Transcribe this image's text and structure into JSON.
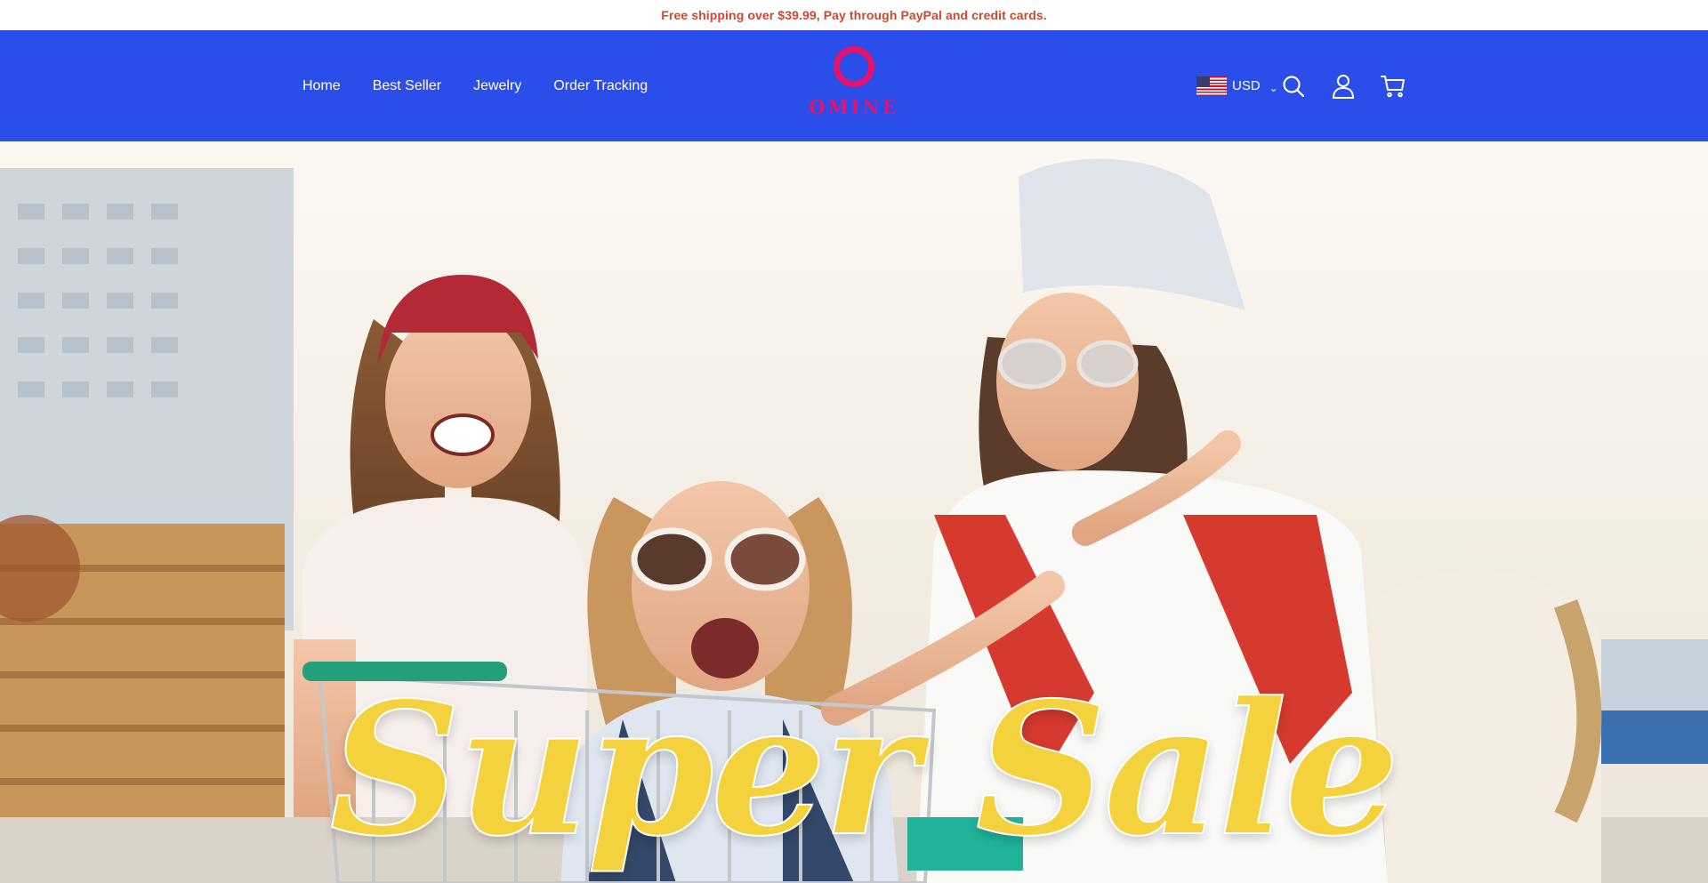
{
  "announcement": "Free shipping over $39.99, Pay through PayPal and credit cards.",
  "nav": {
    "items": [
      {
        "label": "Home"
      },
      {
        "label": "Best Seller"
      },
      {
        "label": "Jewelry"
      },
      {
        "label": "Order Tracking"
      }
    ]
  },
  "logo": {
    "text": "OMINE"
  },
  "currency": {
    "code": "USD",
    "flag_icon": "us-flag-icon",
    "chevron_icon": "chevron-down-icon"
  },
  "toolbar_icons": [
    "search-icon",
    "user-icon",
    "cart-icon"
  ],
  "hero": {
    "headline": "Super Sale"
  },
  "colors": {
    "announcement_text": "#d4462b",
    "header_bg": "#2b4eea",
    "logo": "#e6126b",
    "headline": "#f3d23e"
  }
}
